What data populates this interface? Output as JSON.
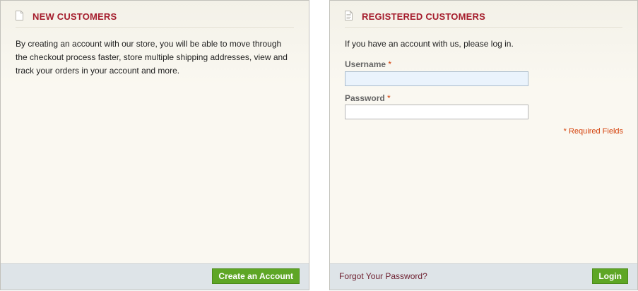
{
  "new_customers": {
    "title": "NEW CUSTOMERS",
    "text": "By creating an account with our store, you will be able to move through the checkout process faster, store multiple shipping addresses, view and track your orders in your account and more.",
    "create_button": "Create an Account",
    "icon": "document-icon"
  },
  "registered_customers": {
    "title": "REGISTERED CUSTOMERS",
    "intro": "If you have an account with us, please log in.",
    "username_label": "Username",
    "password_label": "Password",
    "required_mark": "*",
    "required_note": "* Required Fields",
    "forgot_link": "Forgot Your Password?",
    "login_button": "Login",
    "username_value": "",
    "password_value": "",
    "icon": "document-lines-icon"
  },
  "colors": {
    "title": "#a51d2d",
    "button": "#5ea625",
    "required": "#d4400a",
    "footer": "#dee4e8"
  }
}
